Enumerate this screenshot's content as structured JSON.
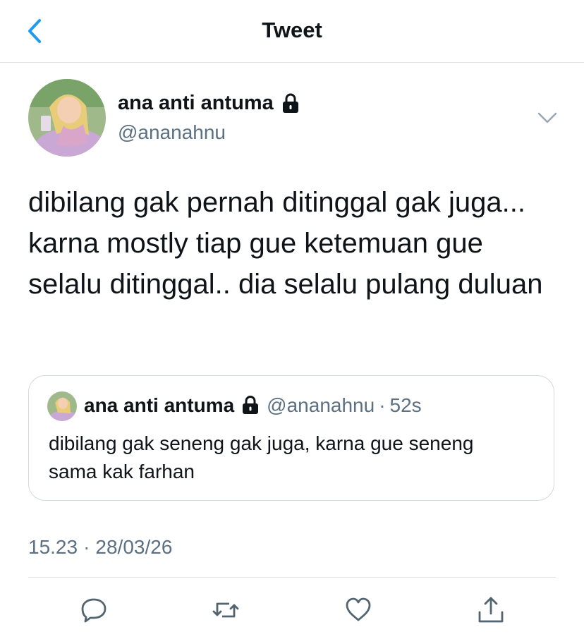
{
  "nav": {
    "title": "Tweet"
  },
  "tweet": {
    "author_name": "ana anti antuma",
    "handle": "@ananahnu",
    "text": "dibilang gak pernah ditinggal gak juga... karna mostly tiap gue ketemuan gue selalu ditinggal.. dia selalu pulang duluan",
    "time": "15.23",
    "separator": "·",
    "date": "28/03/26"
  },
  "quoted_tweet": {
    "author_name": "ana anti antuma",
    "handle": "@ananahnu",
    "separator": "·",
    "age": "52s",
    "text": "dibilang gak seneng gak juga, karna gue seneng sama kak farhan"
  },
  "actions": [
    "reply-icon",
    "retweet-icon",
    "like-icon",
    "share-icon"
  ],
  "colors": {
    "accent": "#1d9bf0",
    "secondary_text": "#5b7083",
    "border": "#dfe3e6"
  }
}
